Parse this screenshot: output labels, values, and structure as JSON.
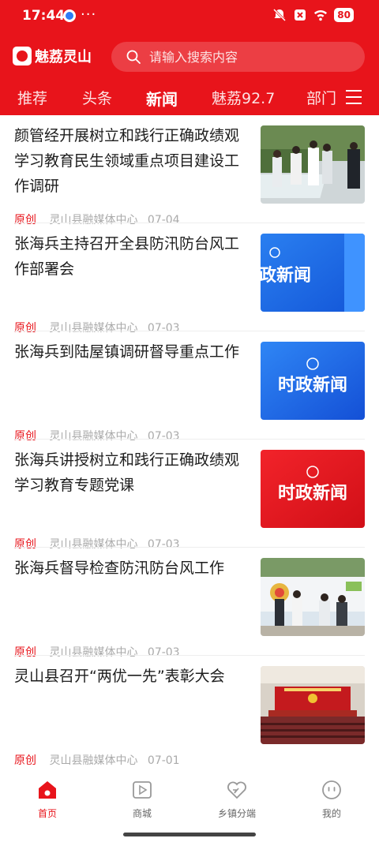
{
  "status_bar": {
    "time": "17:44",
    "dots": "···",
    "battery": "80"
  },
  "header": {
    "logo_text": "魅荔灵山",
    "search_placeholder": "请输入搜索内容",
    "tabs": [
      "推荐",
      "头条",
      "新闻",
      "魅荔92.7",
      "部门"
    ],
    "active_tab": "新闻"
  },
  "news": [
    {
      "title": "颜管经开展树立和践行正确政绩观学习教育民生领域重点项目建设工作调研",
      "badge": "原创",
      "source": "灵山县融媒体中心",
      "date": "07-04",
      "thumb": "photo-field-visit"
    },
    {
      "title": "张海兵主持召开全县防汛防台风工作部署会",
      "badge": "原创",
      "source": "灵山县融媒体中心",
      "date": "07-03",
      "thumb": "blue-banner",
      "thumb_text": "政新闻"
    },
    {
      "title": "张海兵到陆屋镇调研督导重点工作",
      "badge": "原创",
      "source": "灵山县融媒体中心",
      "date": "07-03",
      "thumb": "blue-banner",
      "thumb_text": "时政新闻"
    },
    {
      "title": "张海兵讲授树立和践行正确政绩观学习教育专题党课",
      "badge": "原创",
      "source": "灵山县融媒体中心",
      "date": "07-03",
      "thumb": "red-banner",
      "thumb_text": "时政新闻"
    },
    {
      "title": "张海兵督导检查防汛防台风工作",
      "badge": "原创",
      "source": "灵山县融媒体中心",
      "date": "07-03",
      "thumb": "photo-inspection"
    },
    {
      "title": "灵山县召开“两优一先”表彰大会",
      "badge": "原创",
      "source": "灵山县融媒体中心",
      "date": "07-01",
      "thumb": "photo-conference"
    }
  ],
  "tabbar": [
    {
      "label": "首页",
      "icon": "home-icon",
      "active": true
    },
    {
      "label": "商城",
      "icon": "video-icon",
      "active": false
    },
    {
      "label": "乡镇分端",
      "icon": "heart-icon",
      "active": false
    },
    {
      "label": "我的",
      "icon": "smile-icon",
      "active": false
    }
  ],
  "colors": {
    "brand": "#e8141b",
    "meta": "#aaaaaa",
    "tab_inactive": "#666666"
  }
}
